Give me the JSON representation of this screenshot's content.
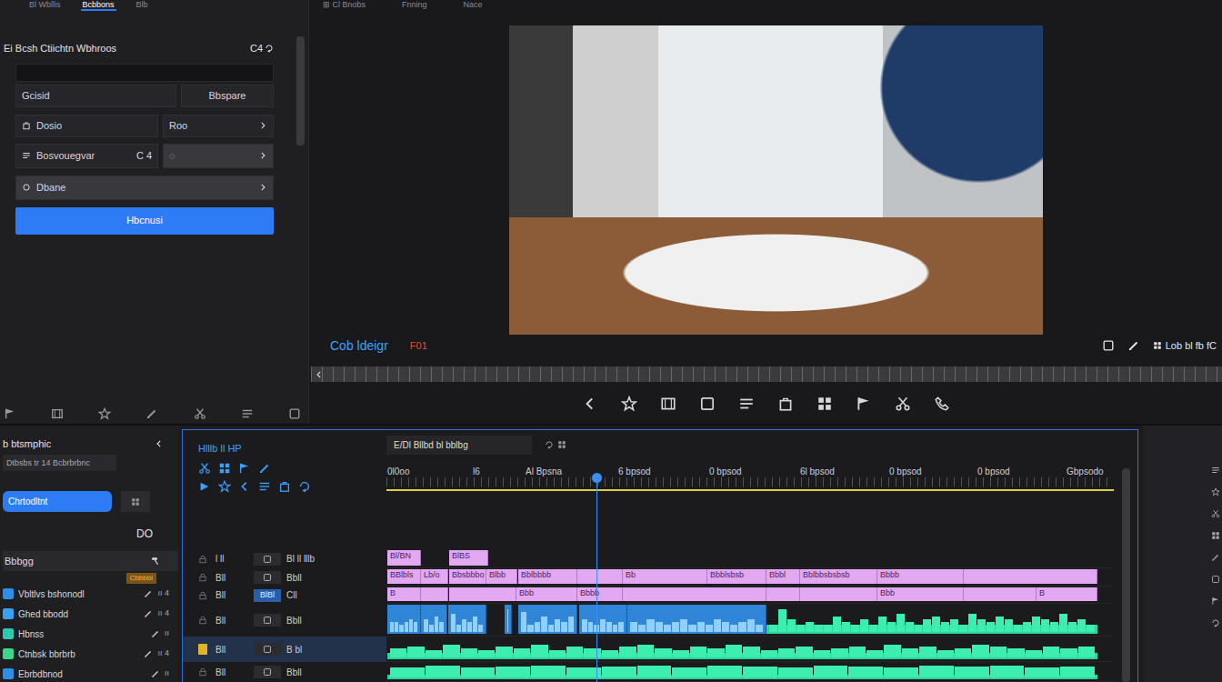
{
  "menu": [
    "⊞ Cl Bnobs",
    "Fnning",
    "Nace"
  ],
  "left_panel": {
    "tabs": [
      {
        "label": "Bl Wbllis",
        "selected": false
      },
      {
        "label": "Bcbbons",
        "selected": true
      },
      {
        "label": "Blb",
        "selected": false
      }
    ],
    "title": "Ei Bcsh Ctiichtn Wbhroos",
    "title_badge": "C4",
    "rows": [
      {
        "kind": "pair",
        "label": "Gcisid",
        "value": "Bbspare"
      },
      {
        "kind": "dropdown",
        "label": "Dosio",
        "value": "Roo"
      },
      {
        "kind": "dropdown",
        "label": "Bosvouegvar",
        "meta": "C 4",
        "value": "◌"
      },
      {
        "kind": "wide",
        "label": "Dbane"
      }
    ],
    "button": "Hbcnusi"
  },
  "preview": {
    "timecode": "Cob ldeigr",
    "frame": "F01",
    "zoom": "Lob bl fb fC"
  },
  "bin": {
    "title": "b btsmphic",
    "search": "Dtbsbs tr 14 Bcbrbrbnc",
    "button": "Chrtodltnt",
    "count": "DO",
    "group": "Bbbgg",
    "tag": "Cbbbbl",
    "items": [
      {
        "label": "Vbltlvs bshonodl",
        "meta": "ıı 4",
        "color": "#2f8ee8"
      },
      {
        "label": "Ghed bbodd",
        "meta": "ıı 4",
        "color": "#3aa0f0"
      },
      {
        "label": "Hbnss",
        "meta": "ıı",
        "color": "#2fc8b0"
      },
      {
        "label": "Ctnbsk bbrbrb",
        "meta": "ıı 4",
        "color": "#3ad68a"
      },
      {
        "label": "Ebrbdbnod",
        "meta": "ıı",
        "color": "#2f8ee8"
      }
    ]
  },
  "timeline": {
    "title": "Hlllb ll HP",
    "sequence": "E/Dl Bllbd bl bblbg",
    "range": 80,
    "playhead": 23.1,
    "ruler": [
      {
        "text": "0l0oo",
        "at": 0.1
      },
      {
        "text": "l6",
        "at": 9.5
      },
      {
        "text": "Al Bpsna",
        "at": 15.3
      },
      {
        "text": "6 bpsod",
        "at": 25.5
      },
      {
        "text": "0 bpsod",
        "at": 35.5
      },
      {
        "text": "6l bpsod",
        "at": 45.5
      },
      {
        "text": "0 bpsod",
        "at": 55.3
      },
      {
        "text": "0 bpsod",
        "at": 65.0
      },
      {
        "text": "Gbpsodo",
        "at": 74.8
      }
    ],
    "tracks": [
      {
        "name": "l ll",
        "label": "Bl ll lllb",
        "selected": false,
        "clips": [
          {
            "kind": "title",
            "start": 0.1,
            "length": 3.7,
            "label": "Bl/BN"
          },
          {
            "kind": "title",
            "start": 6.9,
            "length": 4.3,
            "label": "BlBS"
          }
        ]
      },
      {
        "name": "Bll",
        "label": "Bbll",
        "selected": false,
        "clips": [
          {
            "kind": "title",
            "start": 0.1,
            "length": 3.7,
            "label": "BBlbls"
          },
          {
            "kind": "title",
            "start": 3.8,
            "length": 3.0,
            "label": "Lb/o"
          },
          {
            "kind": "title",
            "start": 6.9,
            "length": 4.1,
            "label": "Bbsbbbo"
          },
          {
            "kind": "title",
            "start": 11.0,
            "length": 3.4,
            "label": "Blbb"
          },
          {
            "kind": "title",
            "start": 14.5,
            "length": 6.5,
            "label": "Bblbbbb"
          },
          {
            "kind": "title",
            "start": 21.0,
            "length": 5.0
          },
          {
            "kind": "title",
            "start": 26.0,
            "length": 9.3,
            "label": "Bb"
          },
          {
            "kind": "title",
            "start": 35.3,
            "length": 6.5,
            "label": "Bbblsbsb"
          },
          {
            "kind": "title",
            "start": 41.8,
            "length": 3.7,
            "label": "Bbbl"
          },
          {
            "kind": "title",
            "start": 45.5,
            "length": 8.5,
            "label": "Bblbbsbsbsb"
          },
          {
            "kind": "title",
            "start": 54.0,
            "length": 9.5,
            "label": "Bbbb"
          },
          {
            "kind": "title",
            "start": 63.5,
            "length": 14.7
          }
        ]
      },
      {
        "name": "Bll",
        "button": "BlBl",
        "label": "Cll",
        "selected": false,
        "clips": [
          {
            "kind": "title",
            "start": 0.1,
            "length": 3.7,
            "label": "B"
          },
          {
            "kind": "title",
            "start": 3.8,
            "length": 3.0
          },
          {
            "kind": "title",
            "start": 6.9,
            "length": 7.4
          },
          {
            "kind": "title",
            "start": 14.3,
            "length": 6.7,
            "label": "Bbb"
          },
          {
            "kind": "title",
            "start": 21.0,
            "length": 5.0,
            "label": "Bbbb"
          },
          {
            "kind": "title",
            "start": 26.0,
            "length": 15.8
          },
          {
            "kind": "title",
            "start": 41.8,
            "length": 3.7
          },
          {
            "kind": "title",
            "start": 45.5,
            "length": 8.5
          },
          {
            "kind": "title",
            "start": 54.0,
            "length": 9.5,
            "label": "Bbb"
          },
          {
            "kind": "title",
            "start": 63.5,
            "length": 8.0
          },
          {
            "kind": "title",
            "start": 71.5,
            "length": 6.7,
            "label": "B"
          }
        ]
      },
      {
        "name": "Bll",
        "label": "Bbll",
        "selected": false,
        "clips": [
          {
            "kind": "video",
            "start": 0.1,
            "length": 3.7,
            "wave": [
              0.4,
              0.4,
              0.3,
              0.4,
              0.5,
              0.4
            ]
          },
          {
            "kind": "video",
            "start": 3.8,
            "length": 2.9,
            "wave": [
              0.5,
              0.3,
              0.6,
              0.4
            ]
          },
          {
            "kind": "video",
            "start": 6.8,
            "length": 4.2,
            "wave": [
              0.7,
              0.3,
              0.5,
              0.4,
              0.6,
              0.3
            ]
          },
          {
            "kind": "video",
            "start": 13.0,
            "length": 0.8,
            "wave": [
              0.9
            ]
          },
          {
            "kind": "video",
            "start": 14.5,
            "length": 6.5,
            "wave": [
              0.8,
              0.3,
              0.4,
              0.6,
              0.3,
              0.5,
              0.4,
              0.6
            ]
          },
          {
            "kind": "video",
            "start": 21.2,
            "length": 5.3,
            "wave": [
              0.5,
              0.4,
              0.3,
              0.5,
              0.4,
              0.3,
              0.4
            ]
          },
          {
            "kind": "video",
            "start": 26.5,
            "length": 15.3,
            "wave": [
              0.4,
              0.3,
              0.5,
              0.4,
              0.3,
              0.4,
              0.5,
              0.3,
              0.4,
              0.3,
              0.5,
              0.4,
              0.3,
              0.4,
              0.5,
              0.3
            ]
          },
          {
            "kind": "audio",
            "start": 41.8,
            "length": 36.4,
            "wave": [
              0.3,
              0.9,
              0.5,
              0.3,
              0.4,
              0.3,
              0.3,
              0.6,
              0.4,
              0.3,
              0.5,
              0.3,
              0.6,
              0.4,
              0.7,
              0.4,
              0.3,
              0.5,
              0.6,
              0.4,
              0.5,
              0.3,
              0.7,
              0.5,
              0.4,
              0.6,
              0.5,
              0.3,
              0.4,
              0.6,
              0.5,
              0.4,
              0.7,
              0.4,
              0.5,
              0.3
            ]
          }
        ]
      },
      {
        "name": "Bll",
        "label": "B bl",
        "selected": true,
        "clips": [
          {
            "kind": "audio",
            "start": 0.1,
            "length": 78.1,
            "wave": [
              0.5,
              0.6,
              0.4,
              0.7,
              0.5,
              0.4,
              0.6,
              0.5,
              0.7,
              0.4,
              0.6,
              0.5,
              0.4,
              0.6,
              0.7,
              0.5,
              0.4,
              0.6,
              0.5,
              0.7,
              0.6,
              0.4,
              0.5,
              0.6,
              0.4,
              0.5,
              0.6,
              0.4,
              0.7,
              0.5,
              0.6,
              0.4,
              0.5,
              0.7,
              0.6,
              0.5,
              0.4,
              0.6,
              0.5,
              0.6
            ]
          }
        ]
      },
      {
        "name": "Bll",
        "label": "Bbll",
        "selected": false,
        "clips": [
          {
            "kind": "audio",
            "start": 0.1,
            "length": 78.1,
            "wave": [
              0.8,
              0.9,
              0.8,
              0.85,
              0.9,
              0.8,
              0.85,
              0.9,
              0.8,
              0.9,
              0.85,
              0.8,
              0.9,
              0.85,
              0.8,
              0.9,
              0.85,
              0.9,
              0.8,
              0.85
            ]
          }
        ]
      }
    ]
  }
}
